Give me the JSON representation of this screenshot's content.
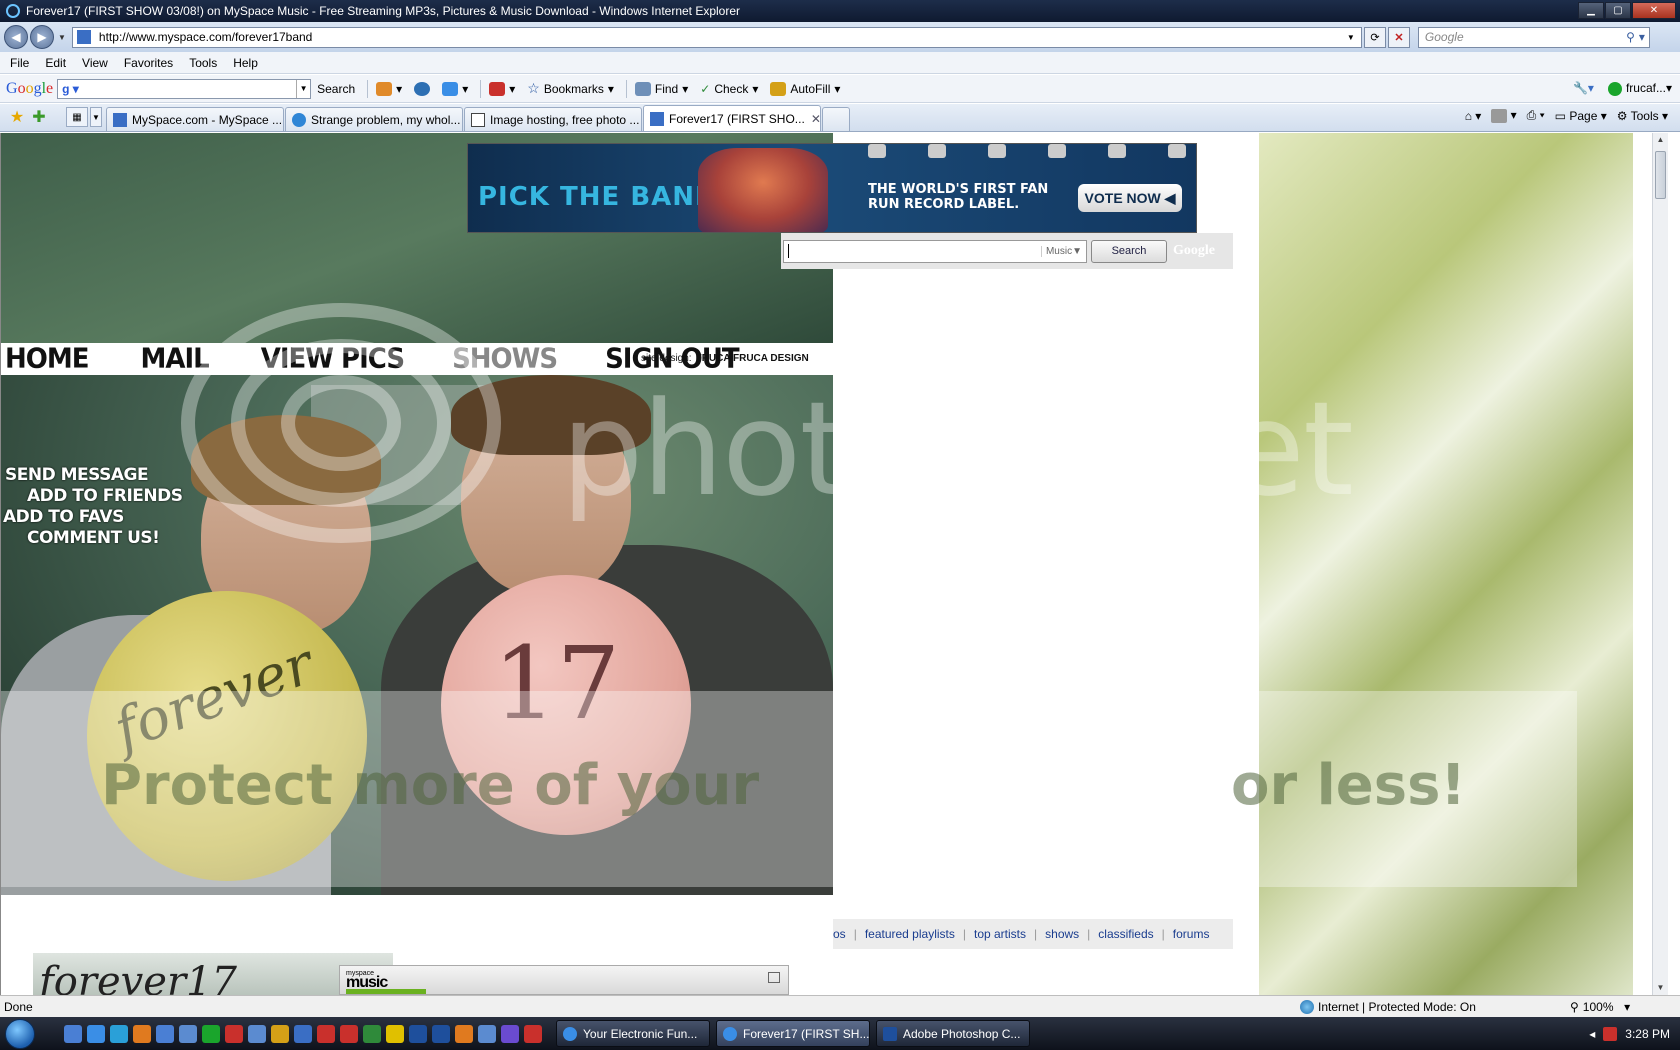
{
  "window": {
    "title": "Forever17 (FIRST SHOW 03/08!) on MySpace Music - Free Streaming MP3s, Pictures & Music Download - Windows Internet Explorer"
  },
  "address": {
    "url": "http://www.myspace.com/forever17band",
    "search_placeholder": "Google"
  },
  "menu": [
    "File",
    "Edit",
    "View",
    "Favorites",
    "Tools",
    "Help"
  ],
  "google_toolbar": {
    "search_label": "Search",
    "bookmarks_label": "Bookmarks",
    "find_label": "Find",
    "check_label": "Check",
    "autofill_label": "AutoFill",
    "account_label": "frucaf..."
  },
  "tabs": [
    {
      "label": "MySpace.com - MySpace ...",
      "icon_color": "#3a6ec4",
      "active": false
    },
    {
      "label": "Strange problem, my whol...",
      "icon_color": "#2f86d6",
      "active": false
    },
    {
      "label": "Image hosting, free photo ...",
      "icon_color": "#444444",
      "active": false
    },
    {
      "label": "Forever17 (FIRST SHO...",
      "icon_color": "#3a6ec4",
      "active": true
    }
  ],
  "command_bar": {
    "page_label": "Page",
    "tools_label": "Tools"
  },
  "profile": {
    "nav": [
      "HOME",
      "MAIL",
      "VIEW PICS",
      "SHOWS",
      "SIGN OUT"
    ],
    "design_prefix": "site design:",
    "design_name": "FRUCA FRUCA DESIGN",
    "side_links": [
      "SEND MESSAGE",
      "ADD TO FRIENDS",
      "ADD TO FAVS",
      "COMMENT US!"
    ],
    "balloon_yellow_text": "forever",
    "balloon_pink_text": "17",
    "logo_text": "forever17"
  },
  "ad": {
    "pick_text": "PICK THE BAND",
    "tagline_1": "THE WORLD'S FIRST FAN",
    "tagline_2": "RUN RECORD LABEL.",
    "vote_label": "VOTE NOW"
  },
  "site_search": {
    "scope": "Music",
    "button": "Search",
    "powered": "Google"
  },
  "site_nav": [
    "os",
    "featured playlists",
    "top artists",
    "shows",
    "classifieds",
    "forums"
  ],
  "player": {
    "brand_small": "myspace",
    "brand": "music"
  },
  "watermark": {
    "text": "photobucket",
    "protect": "Protect more of your",
    "less": "or less!"
  },
  "status": {
    "text": "Done",
    "zone": "Internet | Protected Mode: On",
    "zoom": "100%"
  },
  "taskbar": {
    "buttons": [
      {
        "label": "Your Electronic Fun...",
        "icon_color": "#3a8ee6",
        "active": false
      },
      {
        "label": "Forever17 (FIRST SH...",
        "icon_color": "#3a8ee6",
        "active": true
      },
      {
        "label": "Adobe Photoshop C...",
        "icon_color": "#1e4f9c",
        "active": false
      }
    ],
    "quick_launch_colors": [
      "#4a7fd4",
      "#3a8ee6",
      "#2aa0d8",
      "#e07a1f",
      "#4a7fd4",
      "#5b8bd0",
      "#1aa52c",
      "#c9302c",
      "#5b8bd0",
      "#d4a017",
      "#3a6ec4",
      "#c9302c",
      "#c9302c",
      "#2f8a3a",
      "#e0c000",
      "#1e4f9c",
      "#1e4f9c",
      "#e07a1f",
      "#5b8bd0",
      "#6a4bd0",
      "#c9302c"
    ],
    "clock": "3:28 PM"
  }
}
